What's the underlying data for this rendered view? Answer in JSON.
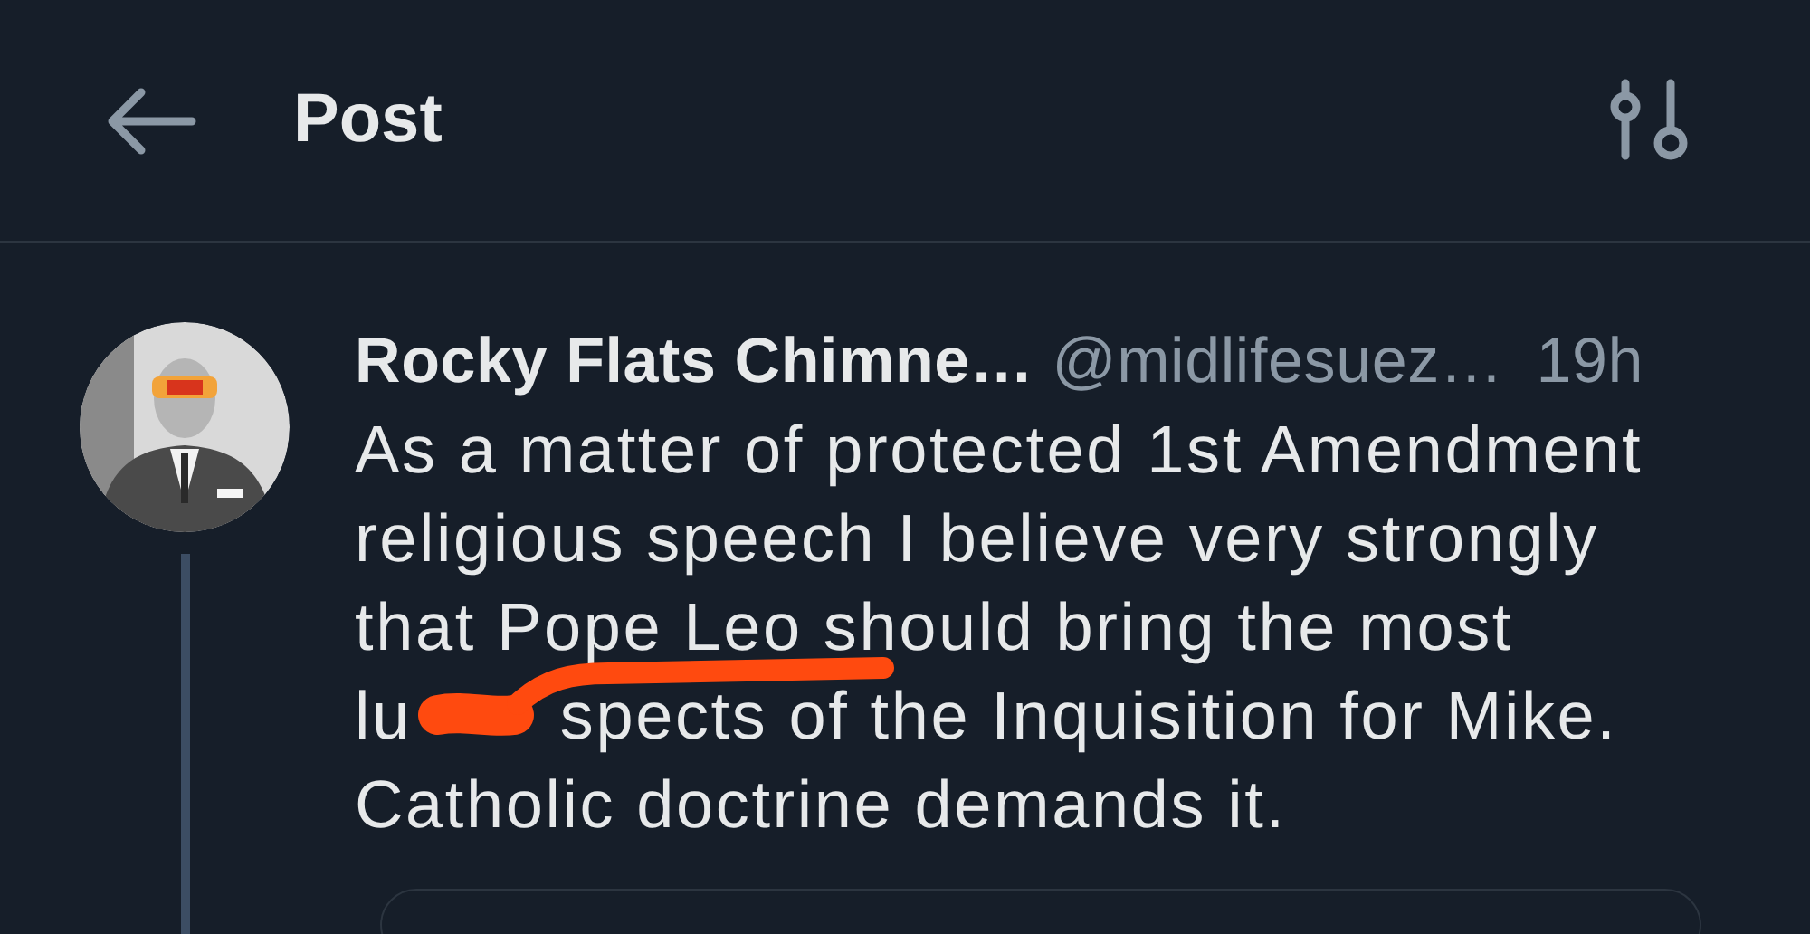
{
  "header": {
    "title": "Post"
  },
  "post": {
    "author_name": "Rocky Flats Chimne…",
    "handle": "@midlifesuez…",
    "time": "19h",
    "avatar": {
      "kind": "picture"
    },
    "body_lines": [
      [
        "As a matter of protected 1st Amendment"
      ],
      [
        "religious speech I believe very strongly"
      ],
      [
        "that Pope Leo should bring the most"
      ],
      [
        "lu",
        "spects of the Inquisition for Mike."
      ],
      [
        "Catholic doctrine demands it."
      ]
    ],
    "redaction": {
      "kind": "scribble",
      "color": "#ff4a0f"
    }
  }
}
